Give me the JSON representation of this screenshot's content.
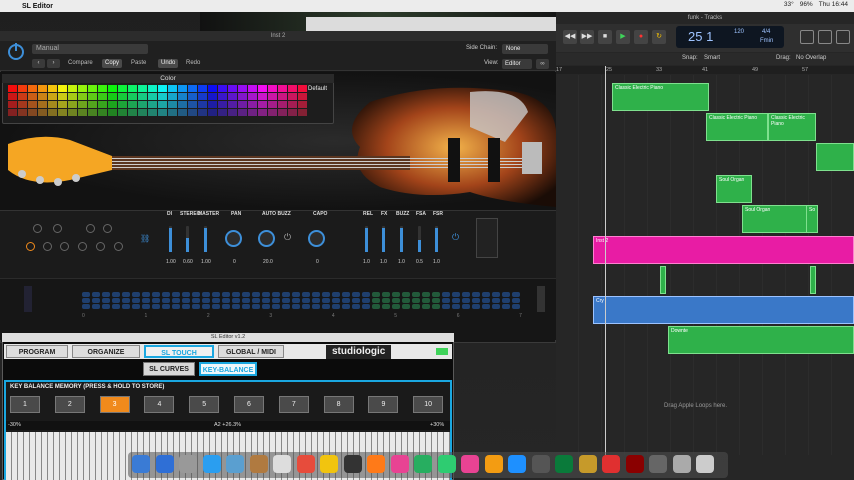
{
  "menubar": {
    "app": "SL Editor",
    "clock": "Thu 16:44",
    "temp": "33°",
    "batt": "96%"
  },
  "plugin": {
    "title": "Inst 2",
    "preset": "Manual",
    "compare": "Compare",
    "copy": "Copy",
    "paste": "Paste",
    "undo": "Undo",
    "redo": "Redo",
    "sidechain_label": "Side Chain:",
    "sidechain_value": "None",
    "view_label": "View:",
    "view_value": "Editor",
    "color_title": "Color",
    "default_label": "Default",
    "controls": [
      {
        "label": "DI",
        "value": "1.00"
      },
      {
        "label": "STEREO",
        "value": "0.60"
      },
      {
        "label": "MASTER",
        "value": "1.00"
      },
      {
        "label": "PAN",
        "value": "0"
      },
      {
        "label": "AUTO BUZZ",
        "value": "20.0"
      },
      {
        "label": "CAPO",
        "value": "0"
      },
      {
        "label": "REL",
        "value": "1.0"
      },
      {
        "label": "FX",
        "value": "1.0"
      },
      {
        "label": "BUZZ",
        "value": "1.0"
      },
      {
        "label": "FSA",
        "value": "0.5"
      },
      {
        "label": "FSR",
        "value": "1.0"
      }
    ],
    "scale_numbers": [
      "0",
      "1",
      "2",
      "3",
      "4",
      "5",
      "6",
      "7"
    ]
  },
  "sl_editor": {
    "title": "SL Editor v1.2",
    "tabs": [
      "PROGRAM",
      "ORGANIZE",
      "SL TOUCH",
      "GLOBAL / MIDI"
    ],
    "logo": "studiologic",
    "subtabs": [
      "SL CURVES",
      "KEY-BALANCE"
    ],
    "kb_title": "KEY BALANCE MEMORY (PRESS & HOLD TO STORE)",
    "memories": [
      "1",
      "2",
      "3",
      "4",
      "5",
      "6",
      "7",
      "8",
      "9",
      "10"
    ],
    "bal_left": "-30%",
    "bal_mid": "A2   +26.3%",
    "bal_right": "+30%"
  },
  "logic": {
    "title": "funk - Tracks",
    "position": "25  1",
    "tempo": "120",
    "key": "Fmin",
    "sig": "4/4",
    "snap_label": "Snap:",
    "snap_value": "Smart",
    "drag_label": "Drag:",
    "drag_value": "No Overlap",
    "ruler": [
      "17",
      "25",
      "33",
      "41",
      "49",
      "57"
    ],
    "drop_hint": "Drag Apple Loops here.",
    "regions": [
      "Classic Electric Piano",
      "Classic Electric Piano",
      "Classic Electric Piano",
      "Soul Organ",
      "Soul Organ",
      "So",
      "Inst 2",
      "Cry",
      "Downte"
    ]
  }
}
